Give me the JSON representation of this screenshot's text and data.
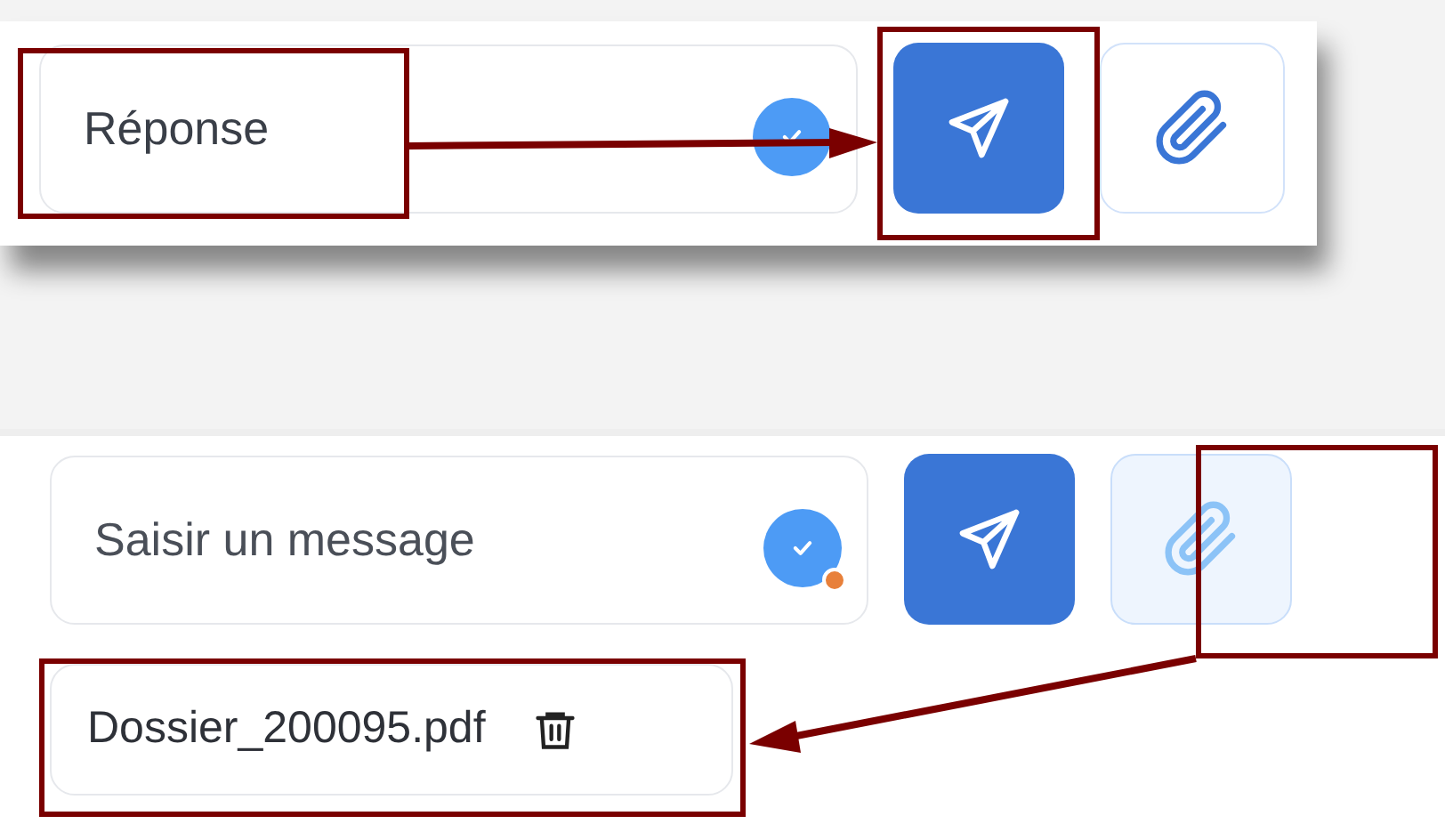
{
  "composers": [
    {
      "input": {
        "value": "Réponse"
      },
      "status_badge": {
        "notification_dot": false
      },
      "attach_button": {
        "selected": false
      }
    },
    {
      "input": {
        "placeholder": "Saisir un message"
      },
      "status_badge": {
        "notification_dot": true
      },
      "attach_button": {
        "selected": true
      },
      "attachments": [
        {
          "file_name": "Dossier_200095.pdf"
        }
      ]
    }
  ]
}
